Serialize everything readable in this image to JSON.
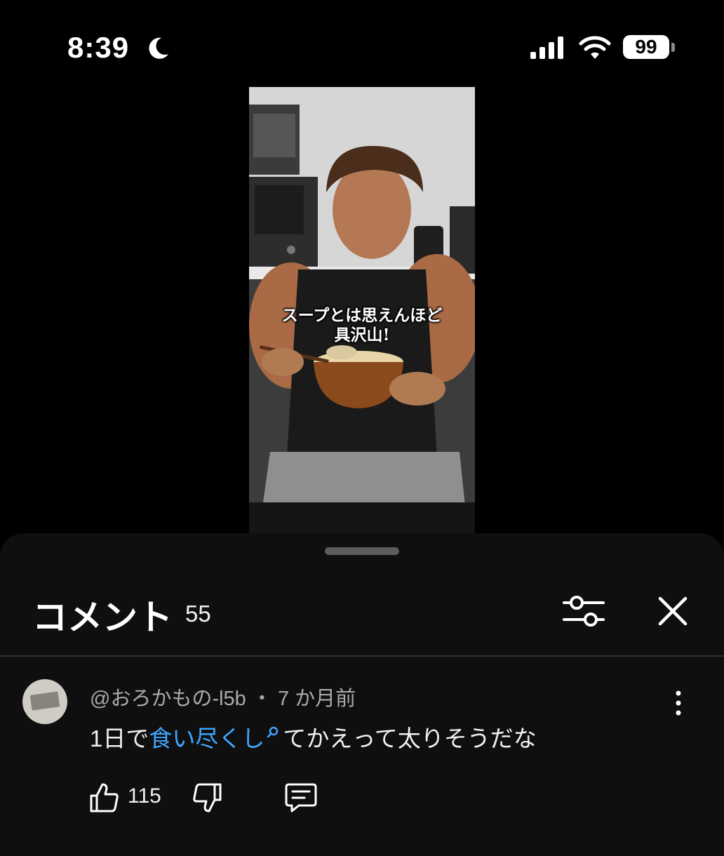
{
  "status_bar": {
    "time": "8:39",
    "battery_percent": "99",
    "icons": [
      "moon-icon",
      "cellular-signal-icon",
      "wifi-icon",
      "battery-icon"
    ]
  },
  "video": {
    "caption_line1": "スープとは思えんほど",
    "caption_line2": "具沢山!"
  },
  "comments": {
    "title": "コメント",
    "count": "55",
    "icons": [
      "filter-icon",
      "close-icon"
    ],
    "items": [
      {
        "author": "@おろかもの-l5b",
        "separator": "・",
        "time": "7 か月前",
        "text_before": "1日で",
        "search_link": "食い尽くし",
        "text_after": "てかえって太りそうだな",
        "likes": "115",
        "icons": [
          "avatar",
          "more-vert-icon",
          "search-icon",
          "thumbs-up-icon",
          "thumbs-down-icon",
          "reply-icon"
        ]
      }
    ]
  },
  "colors": {
    "background": "#000000",
    "sheet": "#0f0f0f",
    "link": "#3ea6ff",
    "secondary_text": "#aaaaaa"
  }
}
